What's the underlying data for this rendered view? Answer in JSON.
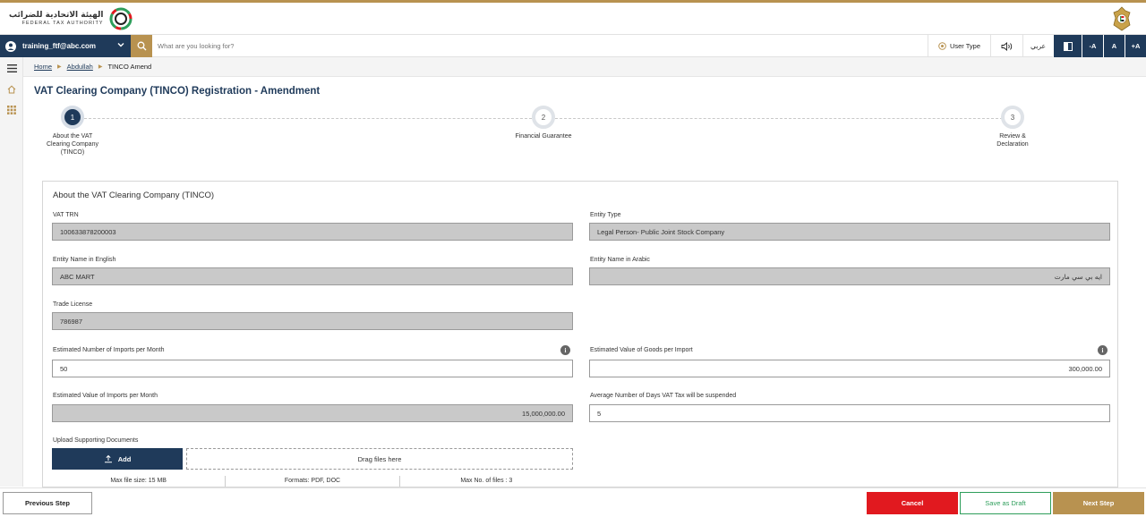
{
  "header": {
    "logo_arabic": "الهيئة الاتحادية للضرائب",
    "logo_english": "FEDERAL TAX AUTHORITY",
    "emblem_icon": "uae-emblem-icon"
  },
  "navbar": {
    "user_email": "training_ftf@abc.com",
    "search_placeholder": "What are you looking for?",
    "user_type_label": "User Type",
    "language_label": "عربي",
    "font_decrease": "-A",
    "font_normal": "A",
    "font_increase": "+A"
  },
  "breadcrumb": {
    "home": "Home",
    "user": "Abdullah",
    "current": "TINCO Amend"
  },
  "page_title": "VAT Clearing Company (TINCO) Registration - Amendment",
  "stepper": {
    "active_step": 1,
    "steps": [
      {
        "number": "1",
        "label": "About the VAT Clearing Company (TINCO)"
      },
      {
        "number": "2",
        "label": "Financial Guarantee"
      },
      {
        "number": "3",
        "label": "Review & Declaration"
      }
    ]
  },
  "form": {
    "section_title": "About the VAT Clearing Company (TINCO)",
    "vat_trn": {
      "label": "VAT TRN",
      "value": "100633878200003"
    },
    "entity_type": {
      "label": "Entity Type",
      "value": "Legal Person- Public Joint Stock Company"
    },
    "entity_name_en": {
      "label": "Entity Name in English",
      "value": "ABC MART"
    },
    "entity_name_ar": {
      "label": "Entity Name in Arabic",
      "value": "ايه بي سي مارت"
    },
    "trade_license": {
      "label": "Trade License",
      "value": "786987"
    },
    "imports_per_month": {
      "label": "Estimated Number of Imports per Month",
      "value": "50"
    },
    "value_per_import": {
      "label": "Estimated Value of Goods per Import",
      "value": "300,000.00"
    },
    "value_imports_month": {
      "label": "Estimated Value of Imports per Month",
      "value": "15,000,000.00"
    },
    "avg_days_suspended": {
      "label": "Average Number of Days VAT Tax will be suspended",
      "value": "5"
    },
    "upload": {
      "label": "Upload Supporting Documents",
      "add_label": "Add",
      "drop_label": "Drag files here",
      "max_size": "Max file size: 15 MB",
      "formats": "Formats: PDF, DOC",
      "max_files": "Max No. of files : 3"
    }
  },
  "footer": {
    "previous": "Previous Step",
    "cancel": "Cancel",
    "save_draft": "Save as Draft",
    "next": "Next Step"
  },
  "colors": {
    "primary": "#1f3a5a",
    "gold": "#b89250",
    "cancel": "#e1191f",
    "draft": "#2e9e5b"
  }
}
